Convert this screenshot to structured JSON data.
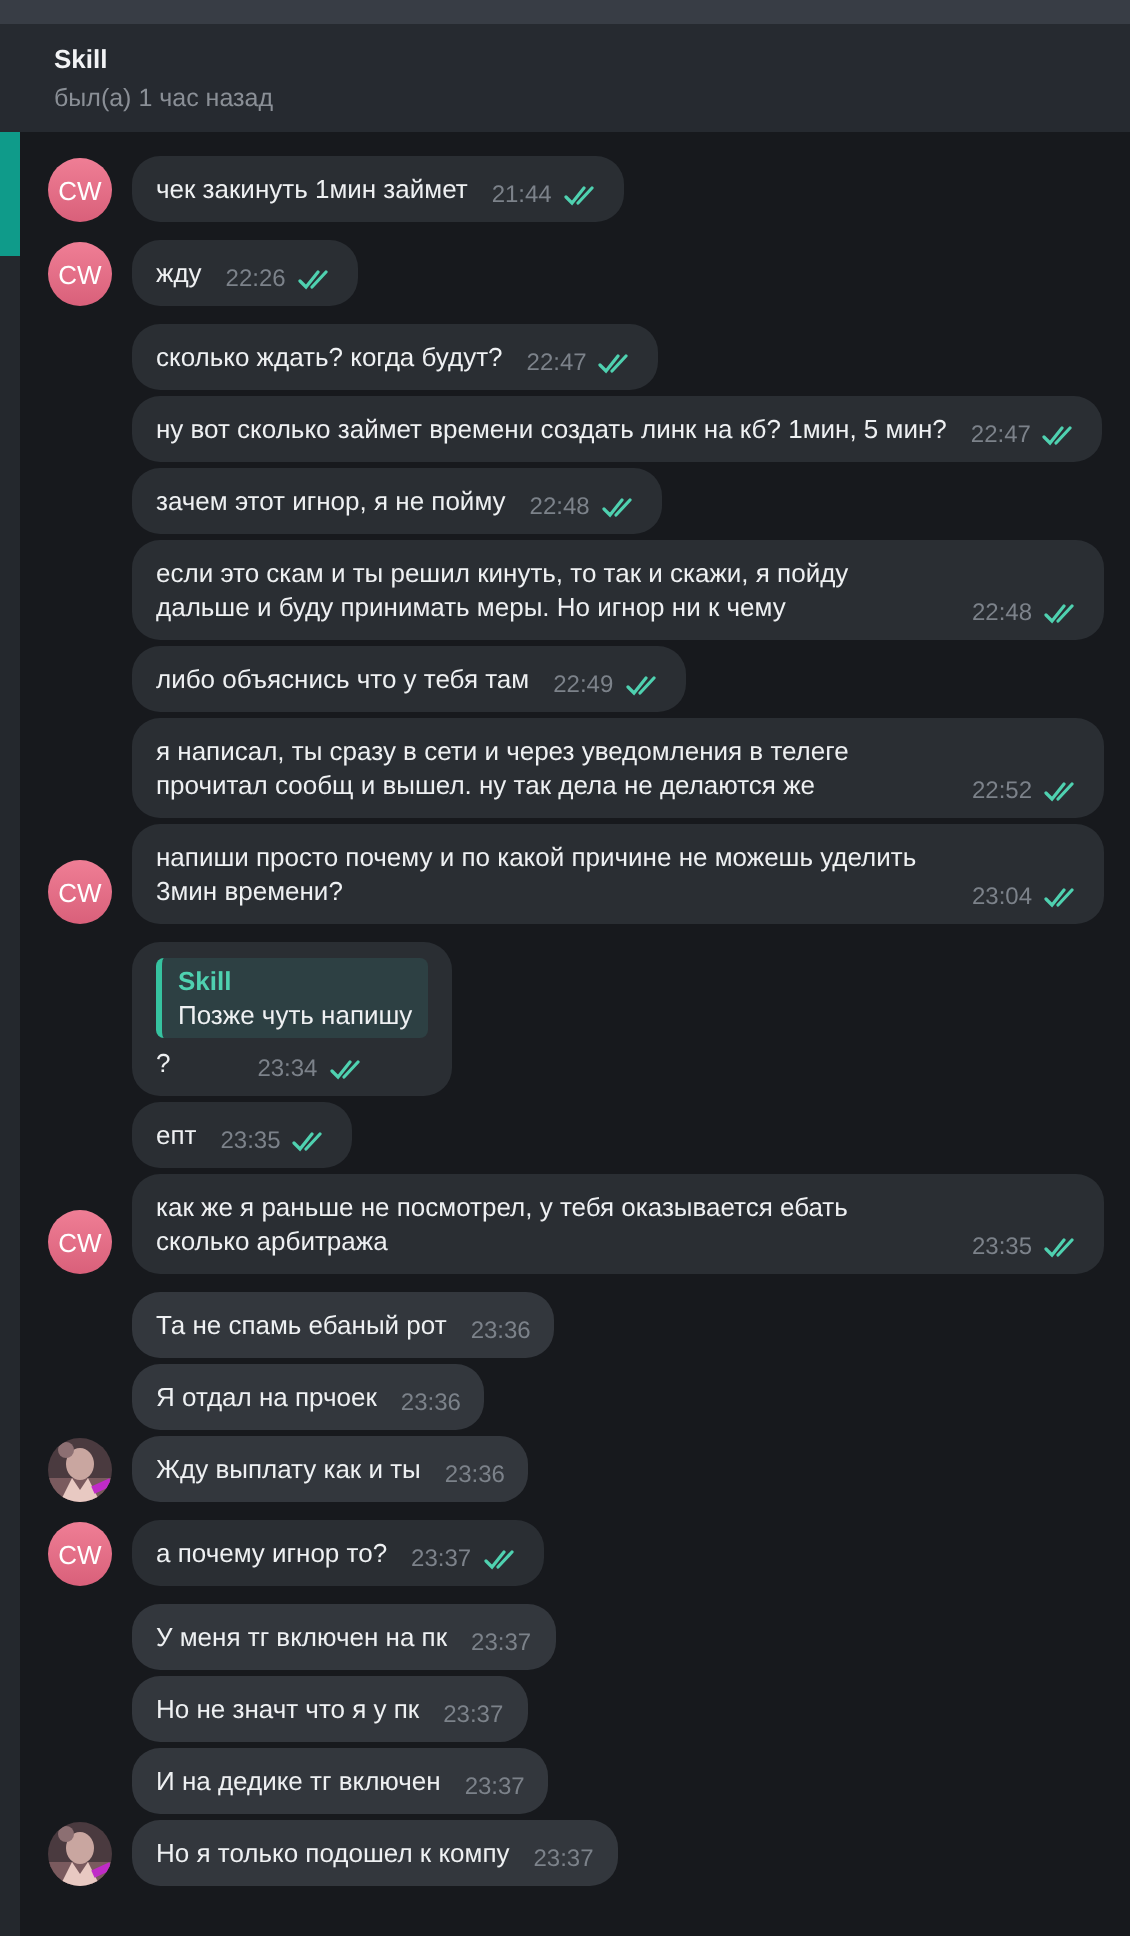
{
  "header": {
    "title": "Skill",
    "status": "был(а) 1 час назад"
  },
  "groups": [
    {
      "kind": "outgoing",
      "avatar": "CW",
      "messages": [
        {
          "text": "чек закинуть 1мин займет",
          "time": "21:44",
          "read": true
        }
      ]
    },
    {
      "kind": "outgoing",
      "avatar": "CW",
      "messages": [
        {
          "text": "жду",
          "time": "22:26",
          "read": true
        }
      ]
    },
    {
      "kind": "outgoing",
      "avatar": "CW",
      "messages": [
        {
          "text": "сколько ждать? когда будут?",
          "time": "22:47",
          "read": true
        },
        {
          "text": "ну вот сколько займет времени создать линк на кб? 1мин, 5 мин?",
          "time": "22:47",
          "read": true
        },
        {
          "text": "зачем этот игнор, я не пойму",
          "time": "22:48",
          "read": true
        },
        {
          "text": "если это скам и ты решил кинуть, то так и скажи, я пойду дальше и буду принимать меры. Но игнор ни к чему",
          "time": "22:48",
          "read": true
        },
        {
          "text": "либо объяснись что у тебя там",
          "time": "22:49",
          "read": true
        },
        {
          "text": "я написал, ты сразу в сети и через уведомления в телеге прочитал сообщ и вышел. ну так дела не делаются же",
          "time": "22:52",
          "read": true
        },
        {
          "text": "напиши просто почему и по какой причине не можешь уделить 3мин времени?",
          "time": "23:04",
          "read": true
        }
      ]
    },
    {
      "kind": "outgoing",
      "avatar": "CW",
      "messages": [
        {
          "reply": {
            "author": "Skill",
            "text": "Позже чуть напишу"
          },
          "text": "?",
          "time": "23:34",
          "read": true
        },
        {
          "text": "епт",
          "time": "23:35",
          "read": true
        },
        {
          "text": "как же я раньше не посмотрел, у тебя оказывается ебать сколько арбитража",
          "time": "23:35",
          "read": true
        }
      ]
    },
    {
      "kind": "incoming",
      "messages": [
        {
          "text": "Та не спамь ебаный рот",
          "time": "23:36",
          "read": false
        },
        {
          "text": "Я отдал на прчоек",
          "time": "23:36",
          "read": false
        },
        {
          "text": "Жду выплату как и ты",
          "time": "23:36",
          "read": false
        }
      ]
    },
    {
      "kind": "outgoing",
      "avatar": "CW",
      "messages": [
        {
          "text": "а почему игнор то?",
          "time": "23:37",
          "read": true
        }
      ]
    },
    {
      "kind": "incoming",
      "messages": [
        {
          "text": "У меня тг включен на пк",
          "time": "23:37",
          "read": false
        },
        {
          "text": "Но не значт что я у пк",
          "time": "23:37",
          "read": false
        },
        {
          "text": "И на дедике тг включен",
          "time": "23:37",
          "read": false
        },
        {
          "text": "Но я только подошел к компу",
          "time": "23:37",
          "read": false
        }
      ]
    }
  ]
}
